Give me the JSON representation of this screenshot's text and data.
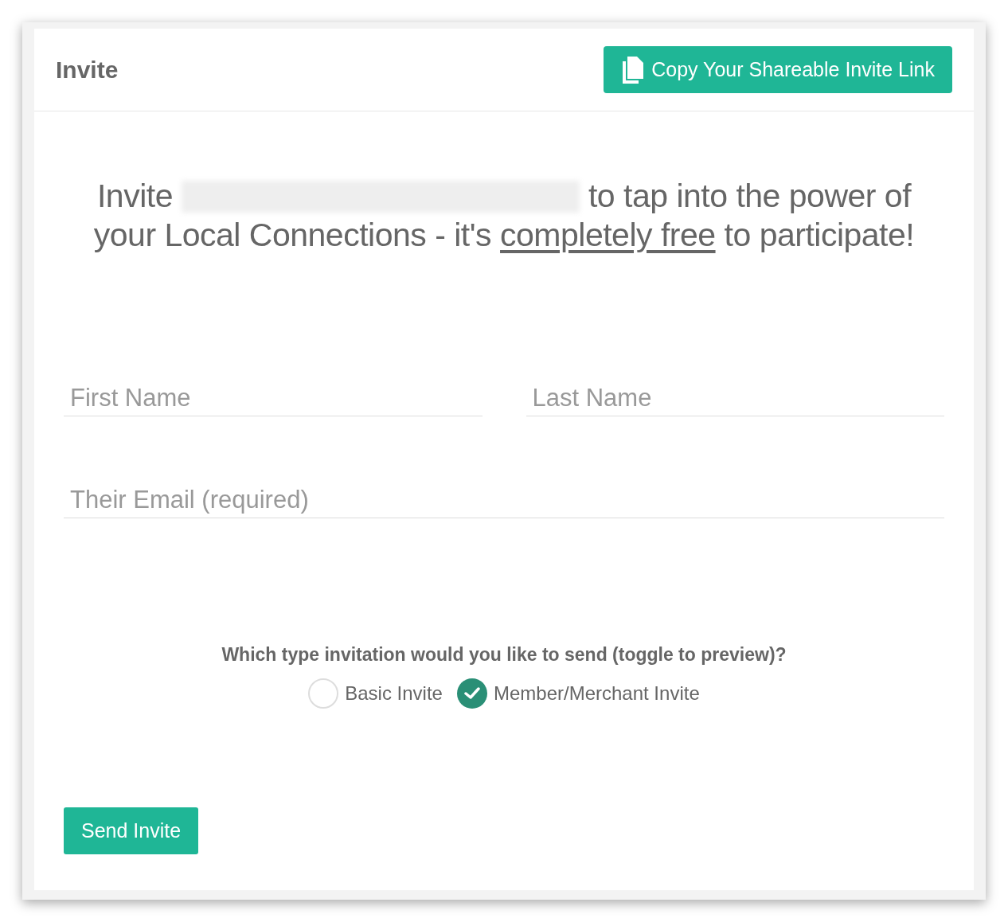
{
  "header": {
    "title": "Invite",
    "copy_button": "Copy Your Shareable Invite Link"
  },
  "headline": {
    "before": "Invite",
    "redacted": true,
    "after": "to tap into the power of",
    "line2_before": "your Local Connections - it's",
    "link": "completely free",
    "line2_after": "to participate!"
  },
  "fields": [
    {
      "placeholder": "First Name"
    },
    {
      "placeholder": "Last Name"
    }
  ],
  "email": {
    "placeholder": "Their Email (required)"
  },
  "invite_type": {
    "question": "Which type invitation would you like to send (toggle to preview)?",
    "options": [
      {
        "label": "Basic Invite",
        "selected": false
      },
      {
        "label": "Member/Merchant Invite",
        "selected": true
      }
    ]
  },
  "send_button": "Send Invite"
}
